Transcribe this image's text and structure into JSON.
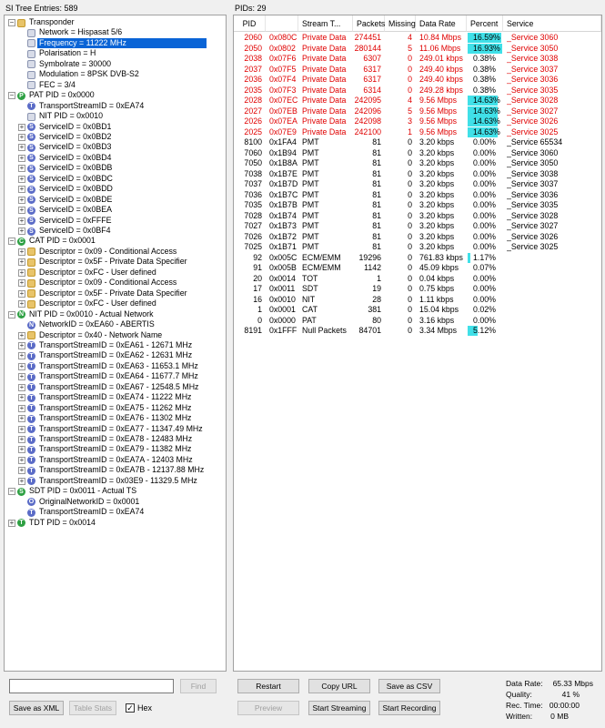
{
  "left_panel": {
    "header": "SI Tree Entries: 589",
    "tree": [
      {
        "depth": 0,
        "exp": "-",
        "icon": "folder",
        "text": "Transponder"
      },
      {
        "depth": 1,
        "exp": "",
        "icon": "item",
        "text": "Network = Hispasat 5/6"
      },
      {
        "depth": 1,
        "exp": "",
        "icon": "item",
        "text": "Frequency = 11222 MHz",
        "selected": true
      },
      {
        "depth": 1,
        "exp": "",
        "icon": "item",
        "text": "Polarisation = H"
      },
      {
        "depth": 1,
        "exp": "",
        "icon": "item",
        "text": "Symbolrate = 30000"
      },
      {
        "depth": 1,
        "exp": "",
        "icon": "item",
        "text": "Modulation = 8PSK DVB-S2"
      },
      {
        "depth": 1,
        "exp": "",
        "icon": "item",
        "text": "FEC = 3/4"
      },
      {
        "depth": 0,
        "exp": "-",
        "icon": "P",
        "text": "PAT PID = 0x0000"
      },
      {
        "depth": 1,
        "exp": "",
        "icon": "t",
        "text": "TransportStreamID = 0xEA74"
      },
      {
        "depth": 1,
        "exp": "",
        "icon": "item",
        "text": "NIT PID = 0x0010"
      },
      {
        "depth": 1,
        "exp": "+",
        "icon": "s",
        "text": "ServiceID = 0x0BD1"
      },
      {
        "depth": 1,
        "exp": "+",
        "icon": "s",
        "text": "ServiceID = 0x0BD2"
      },
      {
        "depth": 1,
        "exp": "+",
        "icon": "s",
        "text": "ServiceID = 0x0BD3"
      },
      {
        "depth": 1,
        "exp": "+",
        "icon": "s",
        "text": "ServiceID = 0x0BD4"
      },
      {
        "depth": 1,
        "exp": "+",
        "icon": "s",
        "text": "ServiceID = 0x0BDB"
      },
      {
        "depth": 1,
        "exp": "+",
        "icon": "s",
        "text": "ServiceID = 0x0BDC"
      },
      {
        "depth": 1,
        "exp": "+",
        "icon": "s",
        "text": "ServiceID = 0x0BDD"
      },
      {
        "depth": 1,
        "exp": "+",
        "icon": "s",
        "text": "ServiceID = 0x0BDE"
      },
      {
        "depth": 1,
        "exp": "+",
        "icon": "s",
        "text": "ServiceID = 0x0BEA"
      },
      {
        "depth": 1,
        "exp": "+",
        "icon": "s",
        "text": "ServiceID = 0xFFFE"
      },
      {
        "depth": 1,
        "exp": "+",
        "icon": "s",
        "text": "ServiceID = 0x0BF4"
      },
      {
        "depth": 0,
        "exp": "-",
        "icon": "C",
        "text": "CAT PID = 0x0001"
      },
      {
        "depth": 1,
        "exp": "+",
        "icon": "d",
        "text": "Descriptor = 0x09 - Conditional Access"
      },
      {
        "depth": 1,
        "exp": "+",
        "icon": "d",
        "text": "Descriptor = 0x5F - Private Data Specifier"
      },
      {
        "depth": 1,
        "exp": "+",
        "icon": "d",
        "text": "Descriptor = 0xFC - User defined"
      },
      {
        "depth": 1,
        "exp": "+",
        "icon": "d",
        "text": "Descriptor = 0x09 - Conditional Access"
      },
      {
        "depth": 1,
        "exp": "+",
        "icon": "d",
        "text": "Descriptor = 0x5F - Private Data Specifier"
      },
      {
        "depth": 1,
        "exp": "+",
        "icon": "d",
        "text": "Descriptor = 0xFC - User defined"
      },
      {
        "depth": 0,
        "exp": "-",
        "icon": "N",
        "text": "NIT PID = 0x0010 - Actual Network"
      },
      {
        "depth": 1,
        "exp": "",
        "icon": "n",
        "text": "NetworkID = 0xEA60 - ABERTIS"
      },
      {
        "depth": 1,
        "exp": "+",
        "icon": "d",
        "text": "Descriptor = 0x40 - Network Name"
      },
      {
        "depth": 1,
        "exp": "+",
        "icon": "t",
        "text": "TransportStreamID = 0xEA61 - 12671 MHz"
      },
      {
        "depth": 1,
        "exp": "+",
        "icon": "t",
        "text": "TransportStreamID = 0xEA62 - 12631 MHz"
      },
      {
        "depth": 1,
        "exp": "+",
        "icon": "t",
        "text": "TransportStreamID = 0xEA63 - 11653.1 MHz"
      },
      {
        "depth": 1,
        "exp": "+",
        "icon": "t",
        "text": "TransportStreamID = 0xEA64 - 11677.7 MHz"
      },
      {
        "depth": 1,
        "exp": "+",
        "icon": "t",
        "text": "TransportStreamID = 0xEA67 - 12548.5 MHz"
      },
      {
        "depth": 1,
        "exp": "+",
        "icon": "t",
        "text": "TransportStreamID = 0xEA74 - 11222 MHz"
      },
      {
        "depth": 1,
        "exp": "+",
        "icon": "t",
        "text": "TransportStreamID = 0xEA75 - 11262 MHz"
      },
      {
        "depth": 1,
        "exp": "+",
        "icon": "t",
        "text": "TransportStreamID = 0xEA76 - 11302 MHz"
      },
      {
        "depth": 1,
        "exp": "+",
        "icon": "t",
        "text": "TransportStreamID = 0xEA77 - 11347.49 MHz"
      },
      {
        "depth": 1,
        "exp": "+",
        "icon": "t",
        "text": "TransportStreamID = 0xEA78 - 12483 MHz"
      },
      {
        "depth": 1,
        "exp": "+",
        "icon": "t",
        "text": "TransportStreamID = 0xEA79 - 11382 MHz"
      },
      {
        "depth": 1,
        "exp": "+",
        "icon": "t",
        "text": "TransportStreamID = 0xEA7A - 12403 MHz"
      },
      {
        "depth": 1,
        "exp": "+",
        "icon": "t",
        "text": "TransportStreamID = 0xEA7B - 12137.88 MHz"
      },
      {
        "depth": 1,
        "exp": "+",
        "icon": "t",
        "text": "TransportStreamID = 0x03E9 - 11329.5 MHz"
      },
      {
        "depth": 0,
        "exp": "-",
        "icon": "S",
        "text": "SDT PID = 0x0011 - Actual TS"
      },
      {
        "depth": 1,
        "exp": "",
        "icon": "o",
        "text": "OriginalNetworkID = 0x0001"
      },
      {
        "depth": 1,
        "exp": "",
        "icon": "t",
        "text": "TransportStreamID = 0xEA74"
      },
      {
        "depth": 0,
        "exp": "+",
        "icon": "T",
        "text": "TDT PID = 0x0014"
      }
    ],
    "icon_letters": {
      "P": "P",
      "C": "C",
      "N": "N",
      "S": "S",
      "T": "T",
      "s": "S",
      "t": "T",
      "n": "N",
      "o": "O",
      "d": "",
      "folder": "",
      "item": ""
    },
    "search_placeholder": "",
    "find_label": "Find",
    "save_xml_label": "Save as XML",
    "table_stats_label": "Table Stats",
    "hex_label": "Hex",
    "hex_checked": true
  },
  "right_panel": {
    "header": "PIDs: 29",
    "columns": [
      "PID",
      "",
      "Stream T...",
      "Packets",
      "Missing",
      "Data Rate",
      "Percent",
      "Service"
    ],
    "rows": [
      {
        "pid": "2060",
        "hex": "0x080C",
        "type": "Private Data",
        "packets": "274451",
        "missing": "4",
        "rate": "10.84 Mbps",
        "percent": "16.59%",
        "pct": 16.59,
        "service": "_Service 3060",
        "red": true
      },
      {
        "pid": "2050",
        "hex": "0x0802",
        "type": "Private Data",
        "packets": "280144",
        "missing": "5",
        "rate": "11.06 Mbps",
        "percent": "16.93%",
        "pct": 16.93,
        "service": "_Service 3050",
        "red": true
      },
      {
        "pid": "2038",
        "hex": "0x07F6",
        "type": "Private Data",
        "packets": "6307",
        "missing": "0",
        "rate": "249.01 kbps",
        "percent": "0.38%",
        "pct": 0.38,
        "service": "_Service 3038",
        "red": true
      },
      {
        "pid": "2037",
        "hex": "0x07F5",
        "type": "Private Data",
        "packets": "6317",
        "missing": "0",
        "rate": "249.40 kbps",
        "percent": "0.38%",
        "pct": 0.38,
        "service": "_Service 3037",
        "red": true
      },
      {
        "pid": "2036",
        "hex": "0x07F4",
        "type": "Private Data",
        "packets": "6317",
        "missing": "0",
        "rate": "249.40 kbps",
        "percent": "0.38%",
        "pct": 0.38,
        "service": "_Service 3036",
        "red": true
      },
      {
        "pid": "2035",
        "hex": "0x07F3",
        "type": "Private Data",
        "packets": "6314",
        "missing": "0",
        "rate": "249.28 kbps",
        "percent": "0.38%",
        "pct": 0.38,
        "service": "_Service 3035",
        "red": true
      },
      {
        "pid": "2028",
        "hex": "0x07EC",
        "type": "Private Data",
        "packets": "242095",
        "missing": "4",
        "rate": "9.56 Mbps",
        "percent": "14.63%",
        "pct": 14.63,
        "service": "_Service 3028",
        "red": true
      },
      {
        "pid": "2027",
        "hex": "0x07EB",
        "type": "Private Data",
        "packets": "242096",
        "missing": "5",
        "rate": "9.56 Mbps",
        "percent": "14.63%",
        "pct": 14.63,
        "service": "_Service 3027",
        "red": true
      },
      {
        "pid": "2026",
        "hex": "0x07EA",
        "type": "Private Data",
        "packets": "242098",
        "missing": "3",
        "rate": "9.56 Mbps",
        "percent": "14.63%",
        "pct": 14.63,
        "service": "_Service 3026",
        "red": true
      },
      {
        "pid": "2025",
        "hex": "0x07E9",
        "type": "Private Data",
        "packets": "242100",
        "missing": "1",
        "rate": "9.56 Mbps",
        "percent": "14.63%",
        "pct": 14.63,
        "service": "_Service 3025",
        "red": true
      },
      {
        "pid": "8100",
        "hex": "0x1FA4",
        "type": "PMT",
        "packets": "81",
        "missing": "0",
        "rate": "3.20 kbps",
        "percent": "0.00%",
        "pct": 0,
        "service": "_Service 65534"
      },
      {
        "pid": "7060",
        "hex": "0x1B94",
        "type": "PMT",
        "packets": "81",
        "missing": "0",
        "rate": "3.20 kbps",
        "percent": "0.00%",
        "pct": 0,
        "service": "_Service 3060"
      },
      {
        "pid": "7050",
        "hex": "0x1B8A",
        "type": "PMT",
        "packets": "81",
        "missing": "0",
        "rate": "3.20 kbps",
        "percent": "0.00%",
        "pct": 0,
        "service": "_Service 3050"
      },
      {
        "pid": "7038",
        "hex": "0x1B7E",
        "type": "PMT",
        "packets": "81",
        "missing": "0",
        "rate": "3.20 kbps",
        "percent": "0.00%",
        "pct": 0,
        "service": "_Service 3038"
      },
      {
        "pid": "7037",
        "hex": "0x1B7D",
        "type": "PMT",
        "packets": "81",
        "missing": "0",
        "rate": "3.20 kbps",
        "percent": "0.00%",
        "pct": 0,
        "service": "_Service 3037"
      },
      {
        "pid": "7036",
        "hex": "0x1B7C",
        "type": "PMT",
        "packets": "81",
        "missing": "0",
        "rate": "3.20 kbps",
        "percent": "0.00%",
        "pct": 0,
        "service": "_Service 3036"
      },
      {
        "pid": "7035",
        "hex": "0x1B7B",
        "type": "PMT",
        "packets": "81",
        "missing": "0",
        "rate": "3.20 kbps",
        "percent": "0.00%",
        "pct": 0,
        "service": "_Service 3035"
      },
      {
        "pid": "7028",
        "hex": "0x1B74",
        "type": "PMT",
        "packets": "81",
        "missing": "0",
        "rate": "3.20 kbps",
        "percent": "0.00%",
        "pct": 0,
        "service": "_Service 3028"
      },
      {
        "pid": "7027",
        "hex": "0x1B73",
        "type": "PMT",
        "packets": "81",
        "missing": "0",
        "rate": "3.20 kbps",
        "percent": "0.00%",
        "pct": 0,
        "service": "_Service 3027"
      },
      {
        "pid": "7026",
        "hex": "0x1B72",
        "type": "PMT",
        "packets": "81",
        "missing": "0",
        "rate": "3.20 kbps",
        "percent": "0.00%",
        "pct": 0,
        "service": "_Service 3026"
      },
      {
        "pid": "7025",
        "hex": "0x1B71",
        "type": "PMT",
        "packets": "81",
        "missing": "0",
        "rate": "3.20 kbps",
        "percent": "0.00%",
        "pct": 0,
        "service": "_Service 3025"
      },
      {
        "pid": "92",
        "hex": "0x005C",
        "type": "ECM/EMM",
        "packets": "19296",
        "missing": "0",
        "rate": "761.83 kbps",
        "percent": "1.17%",
        "pct": 1.17,
        "service": ""
      },
      {
        "pid": "91",
        "hex": "0x005B",
        "type": "ECM/EMM",
        "packets": "1142",
        "missing": "0",
        "rate": "45.09 kbps",
        "percent": "0.07%",
        "pct": 0.07,
        "service": ""
      },
      {
        "pid": "20",
        "hex": "0x0014",
        "type": "TOT",
        "packets": "1",
        "missing": "0",
        "rate": "0.04 kbps",
        "percent": "0.00%",
        "pct": 0,
        "service": ""
      },
      {
        "pid": "17",
        "hex": "0x0011",
        "type": "SDT",
        "packets": "19",
        "missing": "0",
        "rate": "0.75 kbps",
        "percent": "0.00%",
        "pct": 0,
        "service": ""
      },
      {
        "pid": "16",
        "hex": "0x0010",
        "type": "NIT",
        "packets": "28",
        "missing": "0",
        "rate": "1.11 kbps",
        "percent": "0.00%",
        "pct": 0,
        "service": ""
      },
      {
        "pid": "1",
        "hex": "0x0001",
        "type": "CAT",
        "packets": "381",
        "missing": "0",
        "rate": "15.04 kbps",
        "percent": "0.02%",
        "pct": 0.02,
        "service": ""
      },
      {
        "pid": "0",
        "hex": "0x0000",
        "type": "PAT",
        "packets": "80",
        "missing": "0",
        "rate": "3.16 kbps",
        "percent": "0.00%",
        "pct": 0,
        "service": ""
      },
      {
        "pid": "8191",
        "hex": "0x1FFF",
        "type": "Null Packets",
        "packets": "84701",
        "missing": "0",
        "rate": "3.34 Mbps",
        "percent": "5.12%",
        "pct": 5.12,
        "service": ""
      }
    ],
    "buttons": {
      "restart": "Restart",
      "copy_url": "Copy URL",
      "save_csv": "Save as CSV",
      "preview": "Preview",
      "start_streaming": "Start Streaming",
      "start_recording": "Start Recording"
    },
    "stats": {
      "data_rate_label": "Data Rate:",
      "data_rate": "65.33 Mbps",
      "quality_label": "Quality:",
      "quality": "41 %",
      "rec_time_label": "Rec. Time:",
      "rec_time": "00:00:00",
      "written_label": "Written:",
      "written": "0 MB"
    }
  },
  "colors": {
    "selection": "#0a64d6",
    "alert_text": "#e00000",
    "percent_bar": "#40e0e8"
  }
}
